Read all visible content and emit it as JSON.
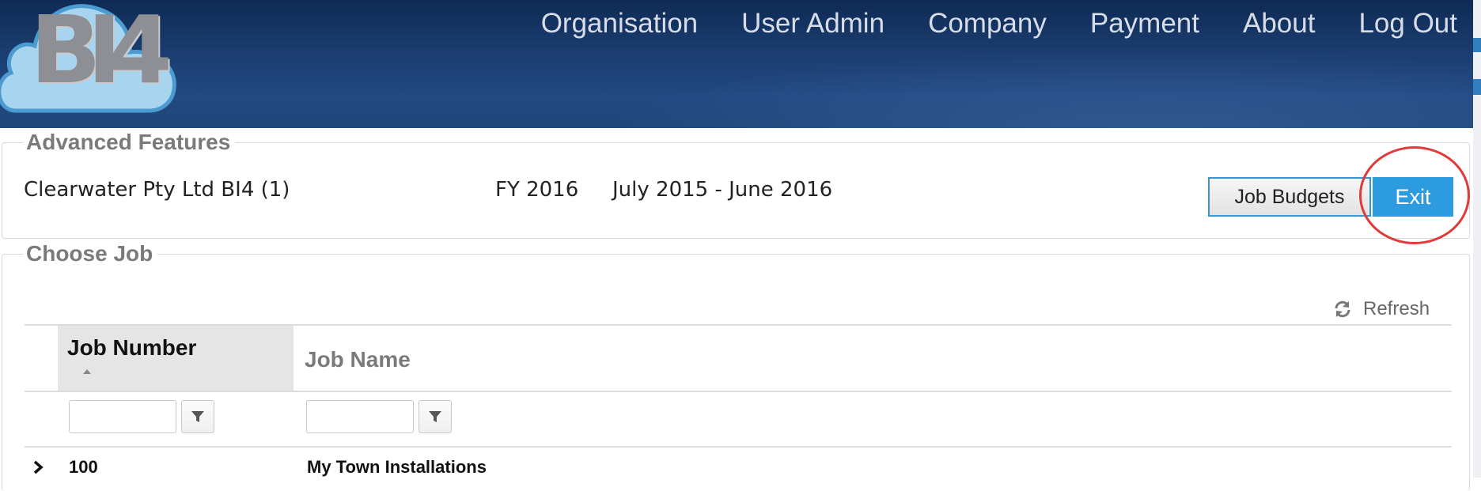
{
  "header": {
    "logo_text": "BI4",
    "nav": [
      "Organisation",
      "User Admin",
      "Company",
      "Payment",
      "About",
      "Log Out"
    ]
  },
  "advanced": {
    "legend": "Advanced Features",
    "company": "Clearwater Pty Ltd BI4 (1)",
    "fy": "FY 2016",
    "period": "July 2015 - June 2016",
    "job_budgets_label": "Job Budgets",
    "exit_label": "Exit"
  },
  "choose_job": {
    "legend": "Choose Job",
    "refresh_label": "Refresh",
    "columns": {
      "job_number": "Job Number",
      "job_name": "Job Name"
    },
    "rows": [
      {
        "number": "100",
        "name": "My Town Installations"
      }
    ]
  },
  "colors": {
    "header_bg": "#1c3f72",
    "accent_blue": "#2c9be0",
    "highlight_red": "#e23a3a"
  },
  "icons": [
    "cloud-logo-icon",
    "refresh-icon",
    "filter-icon",
    "chevron-right-icon",
    "sort-asc-icon"
  ]
}
